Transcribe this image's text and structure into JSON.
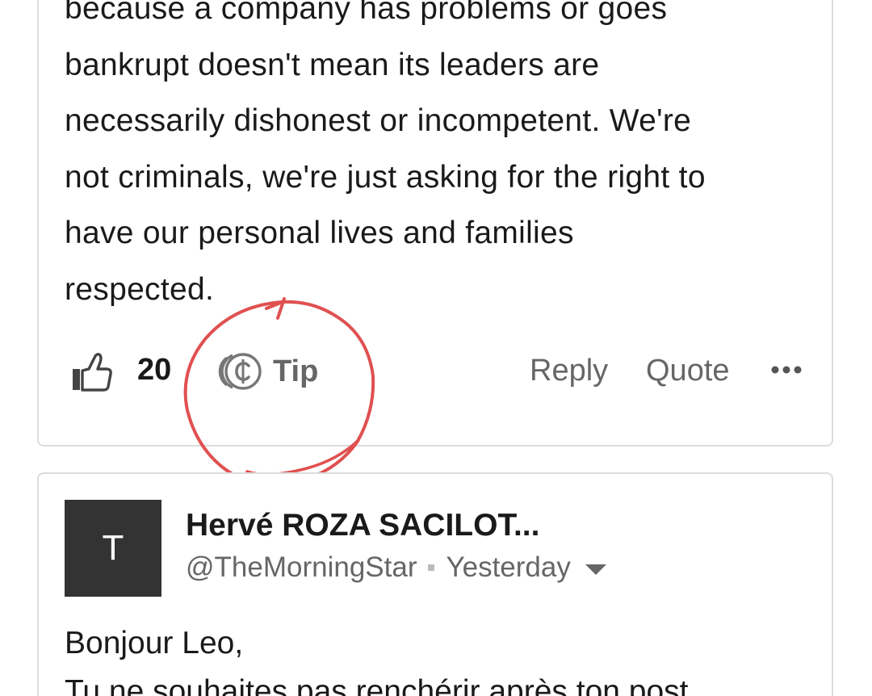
{
  "comment_1": {
    "body_lines": [
      "because a company has problems or goes",
      "bankrupt doesn't mean its leaders are",
      "necessarily dishonest or incompetent. We're",
      "not criminals, we're just asking for the right to",
      "have our personal lives and families",
      "respected."
    ],
    "actions": {
      "like_count": "20",
      "tip_label": "Tip",
      "reply_label": "Reply",
      "quote_label": "Quote",
      "more_icon": "ellipsis-icon"
    }
  },
  "comment_2": {
    "avatar_letter": "T",
    "author_name": "Hervé ROZA SACILOT...",
    "handle": "@TheMorningStar",
    "timestamp": "Yesterday",
    "body_lines": [
      "Bonjour Leo,",
      "Tu ne souhaites pas renchérir après ton post"
    ]
  },
  "colors": {
    "annotation": "#e05050",
    "muted_text": "#666666",
    "avatar_bg": "#333333",
    "card_border": "#dcdcdc"
  }
}
